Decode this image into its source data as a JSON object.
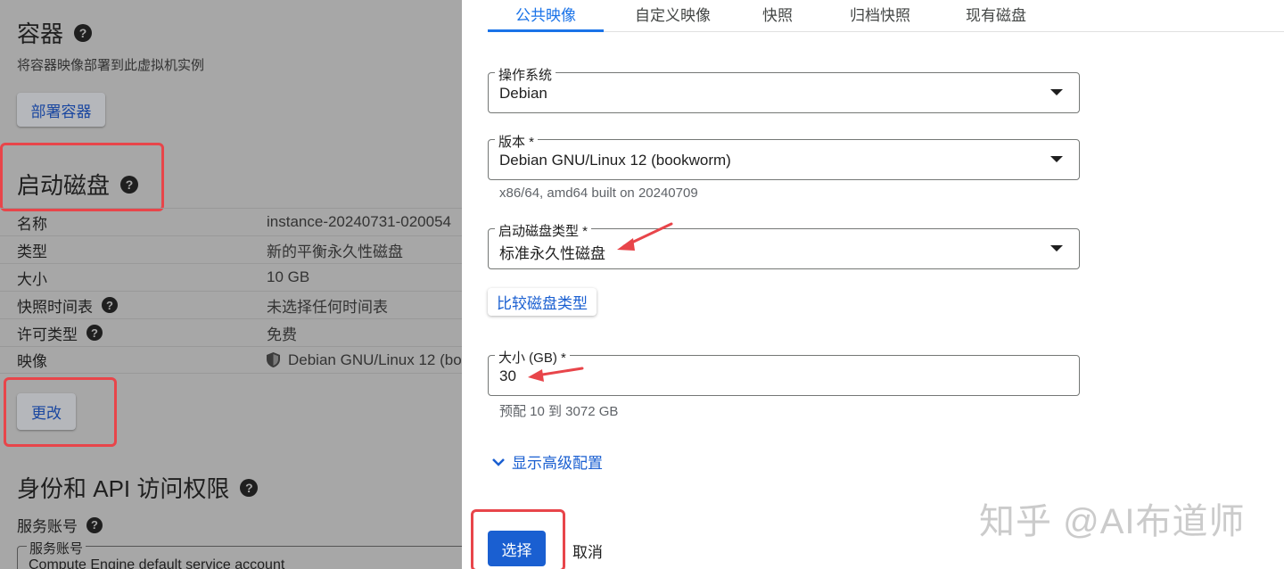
{
  "left": {
    "container": {
      "title": "容器",
      "subtitle": "将容器映像部署到此虚拟机实例",
      "deploy_button": "部署容器"
    },
    "boot_disk": {
      "title": "启动磁盘",
      "rows": [
        {
          "key": "名称",
          "value": "instance-20240731-020054"
        },
        {
          "key": "类型",
          "value": "新的平衡永久性磁盘"
        },
        {
          "key": "大小",
          "value": "10 GB"
        },
        {
          "key": "快照时间表",
          "value": "未选择任何时间表"
        },
        {
          "key": "许可类型",
          "value": "免费"
        },
        {
          "key": "映像",
          "value": "Debian GNU/Linux 12 (bo"
        }
      ],
      "change_button": "更改"
    },
    "identity": {
      "title": "身份和 API 访问权限",
      "service_account_heading": "服务账号",
      "service_account_label": "服务账号",
      "service_account_value": "Compute Engine default service account"
    }
  },
  "panel": {
    "tabs": [
      "公共映像",
      "自定义映像",
      "快照",
      "归档快照",
      "现有磁盘"
    ],
    "os": {
      "label": "操作系统",
      "value": "Debian"
    },
    "version": {
      "label": "版本 *",
      "value": "Debian GNU/Linux 12 (bookworm)",
      "hint": "x86/64, amd64 built on 20240709"
    },
    "disk_type": {
      "label": "启动磁盘类型 *",
      "value": "标准永久性磁盘"
    },
    "compare_button": "比较磁盘类型",
    "size": {
      "label": "大小 (GB) *",
      "value": "30",
      "hint": "预配 10 到 3072 GB"
    },
    "advanced_link": "显示高级配置",
    "select_button": "选择",
    "cancel_button": "取消"
  },
  "watermark": "知乎 @AI布道师",
  "colors": {
    "accent": "#1a73e8",
    "annotation_red": "#e8454a"
  }
}
